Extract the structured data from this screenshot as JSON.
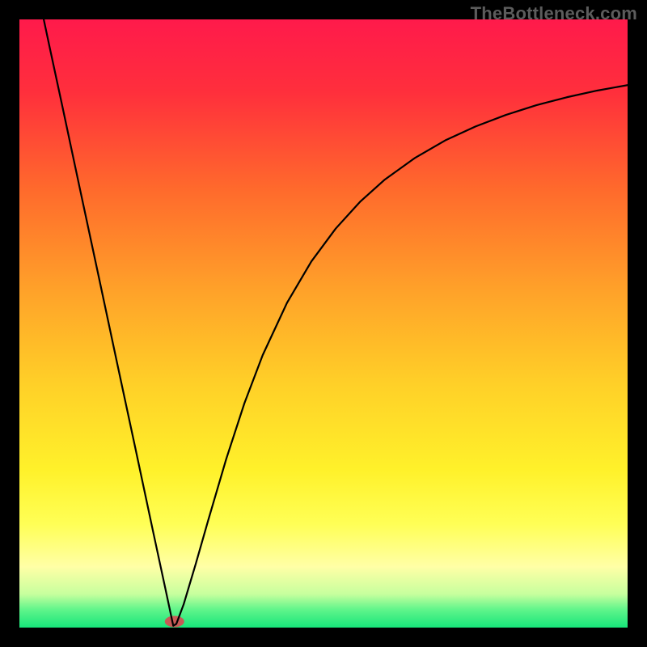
{
  "watermark": "TheBottleneck.com",
  "chart_data": {
    "type": "line",
    "title": "",
    "xlabel": "",
    "ylabel": "",
    "xlim": [
      0,
      100
    ],
    "ylim": [
      0,
      100
    ],
    "grid": false,
    "background_gradient": {
      "stops": [
        {
          "offset": 0.0,
          "color": "#ff1a4b"
        },
        {
          "offset": 0.12,
          "color": "#ff2f3c"
        },
        {
          "offset": 0.28,
          "color": "#ff6a2c"
        },
        {
          "offset": 0.45,
          "color": "#ffa329"
        },
        {
          "offset": 0.6,
          "color": "#ffd028"
        },
        {
          "offset": 0.74,
          "color": "#fff12a"
        },
        {
          "offset": 0.83,
          "color": "#ffff56"
        },
        {
          "offset": 0.9,
          "color": "#ffffa6"
        },
        {
          "offset": 0.945,
          "color": "#c7ff9e"
        },
        {
          "offset": 0.97,
          "color": "#61f58b"
        },
        {
          "offset": 1.0,
          "color": "#17e57a"
        }
      ]
    },
    "marker": {
      "x": 25.5,
      "y": 1.0,
      "color": "#c75a56",
      "rx": 12,
      "ry": 7
    },
    "series": [
      {
        "name": "curve",
        "color": "#000000",
        "width": 2.2,
        "points": [
          {
            "x": 4.0,
            "y": 100.0
          },
          {
            "x": 5.0,
            "y": 95.3
          },
          {
            "x": 7.0,
            "y": 86.0
          },
          {
            "x": 10.0,
            "y": 71.9
          },
          {
            "x": 13.0,
            "y": 57.9
          },
          {
            "x": 16.0,
            "y": 43.8
          },
          {
            "x": 19.0,
            "y": 29.8
          },
          {
            "x": 22.0,
            "y": 15.7
          },
          {
            "x": 24.0,
            "y": 6.4
          },
          {
            "x": 25.0,
            "y": 1.7
          },
          {
            "x": 25.3,
            "y": 0.3
          },
          {
            "x": 25.8,
            "y": 0.6
          },
          {
            "x": 27.0,
            "y": 3.8
          },
          {
            "x": 29.0,
            "y": 10.5
          },
          {
            "x": 31.0,
            "y": 17.5
          },
          {
            "x": 34.0,
            "y": 27.7
          },
          {
            "x": 37.0,
            "y": 36.9
          },
          {
            "x": 40.0,
            "y": 44.8
          },
          {
            "x": 44.0,
            "y": 53.4
          },
          {
            "x": 48.0,
            "y": 60.2
          },
          {
            "x": 52.0,
            "y": 65.6
          },
          {
            "x": 56.0,
            "y": 70.0
          },
          {
            "x": 60.0,
            "y": 73.6
          },
          {
            "x": 65.0,
            "y": 77.2
          },
          {
            "x": 70.0,
            "y": 80.1
          },
          {
            "x": 75.0,
            "y": 82.4
          },
          {
            "x": 80.0,
            "y": 84.3
          },
          {
            "x": 85.0,
            "y": 85.9
          },
          {
            "x": 90.0,
            "y": 87.2
          },
          {
            "x": 95.0,
            "y": 88.3
          },
          {
            "x": 100.0,
            "y": 89.2
          }
        ]
      }
    ]
  }
}
